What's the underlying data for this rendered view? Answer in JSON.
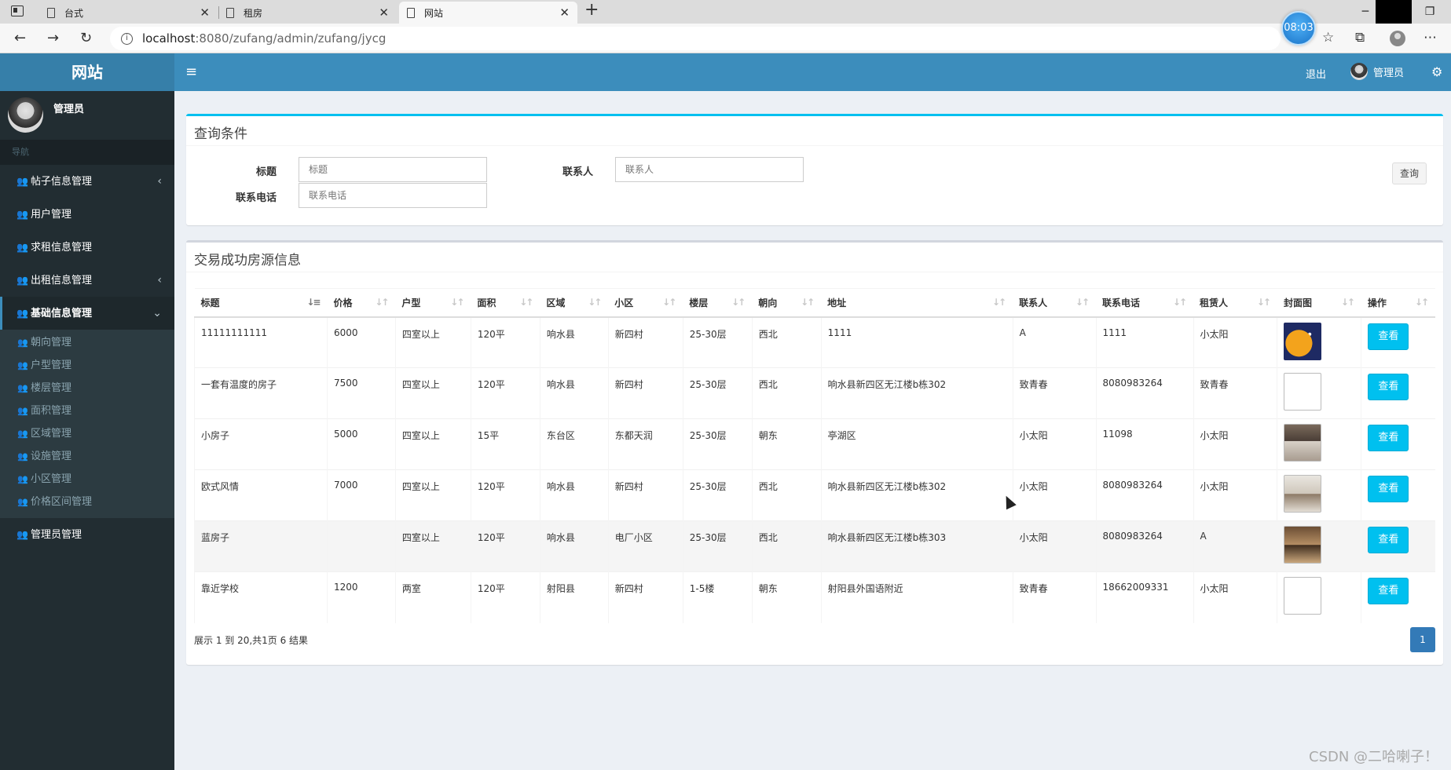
{
  "browser": {
    "tabs": [
      {
        "title": "台式"
      },
      {
        "title": "租房"
      },
      {
        "title": "网站"
      }
    ],
    "url_host": "localhost",
    "url_path": ":8080/zufang/admin/zufang/jycg",
    "timer": "08:03"
  },
  "sidebar": {
    "logo": "网站",
    "username": "管理员",
    "nav_header": "导航",
    "items": [
      {
        "label": "帖子信息管理"
      },
      {
        "label": "用户管理"
      },
      {
        "label": "求租信息管理"
      },
      {
        "label": "出租信息管理"
      },
      {
        "label": "基础信息管理"
      },
      {
        "label": "管理员管理"
      }
    ],
    "subitems": [
      {
        "label": "朝向管理"
      },
      {
        "label": "户型管理"
      },
      {
        "label": "楼层管理"
      },
      {
        "label": "面积管理"
      },
      {
        "label": "区域管理"
      },
      {
        "label": "设施管理"
      },
      {
        "label": "小区管理"
      },
      {
        "label": "价格区间管理"
      }
    ]
  },
  "header": {
    "logout": "退出",
    "username": "管理员"
  },
  "query": {
    "title": "查询条件",
    "title_label": "标题",
    "title_placeholder": "标题",
    "contact_label": "联系人",
    "contact_placeholder": "联系人",
    "phone_label": "联系电话",
    "phone_placeholder": "联系电话",
    "search_button": "查询"
  },
  "list": {
    "title": "交易成功房源信息",
    "columns": [
      "标题",
      "价格",
      "户型",
      "面积",
      "区域",
      "小区",
      "楼层",
      "朝向",
      "地址",
      "联系人",
      "联系电话",
      "租赁人",
      "封面图",
      "操作"
    ],
    "rows": [
      {
        "title": "11111111111",
        "price": "6000",
        "type": "四室以上",
        "area": "120平",
        "region": "响水县",
        "community": "新四村",
        "floor": "25-30层",
        "orient": "西北",
        "address": "1111",
        "contact": "A",
        "phone": "1111",
        "renter": "小太阳",
        "cover": "moon",
        "action": "查看"
      },
      {
        "title": "一套有温度的房子",
        "price": "7500",
        "type": "四室以上",
        "area": "120平",
        "region": "响水县",
        "community": "新四村",
        "floor": "25-30层",
        "orient": "西北",
        "address": "响水县新四区无江楼b栋302",
        "contact": "致青春",
        "phone": "8080983264",
        "renter": "致青春",
        "cover": "broken",
        "action": "查看"
      },
      {
        "title": "小房子",
        "price": "5000",
        "type": "四室以上",
        "area": "15平",
        "region": "东台区",
        "community": "东都天润",
        "floor": "25-30层",
        "orient": "朝东",
        "address": "亭湖区",
        "contact": "小太阳",
        "phone": "11098",
        "renter": "小太阳",
        "cover": "room1",
        "action": "查看"
      },
      {
        "title": "欧式风情",
        "price": "7000",
        "type": "四室以上",
        "area": "120平",
        "region": "响水县",
        "community": "新四村",
        "floor": "25-30层",
        "orient": "西北",
        "address": "响水县新四区无江楼b栋302",
        "contact": "小太阳",
        "phone": "8080983264",
        "renter": "小太阳",
        "cover": "room2",
        "action": "查看"
      },
      {
        "title": "蓝房子",
        "price": "",
        "type": "四室以上",
        "area": "120平",
        "region": "响水县",
        "community": "电厂小区",
        "floor": "25-30层",
        "orient": "西北",
        "address": "响水县新四区无江楼b栋303",
        "contact": "小太阳",
        "phone": "8080983264",
        "renter": "A",
        "cover": "room3",
        "action": "查看"
      },
      {
        "title": "靠近学校",
        "price": "1200",
        "type": "两室",
        "area": "120平",
        "region": "射阳县",
        "community": "新四村",
        "floor": "1-5楼",
        "orient": "朝东",
        "address": "射阳县外国语附近",
        "contact": "致青春",
        "phone": "18662009331",
        "renter": "小太阳",
        "cover": "broken",
        "action": "查看"
      }
    ],
    "page_info": "展示 1 到 20,共1页 6 结果",
    "current_page": "1"
  },
  "watermark": "CSDN @二哈喇子！"
}
